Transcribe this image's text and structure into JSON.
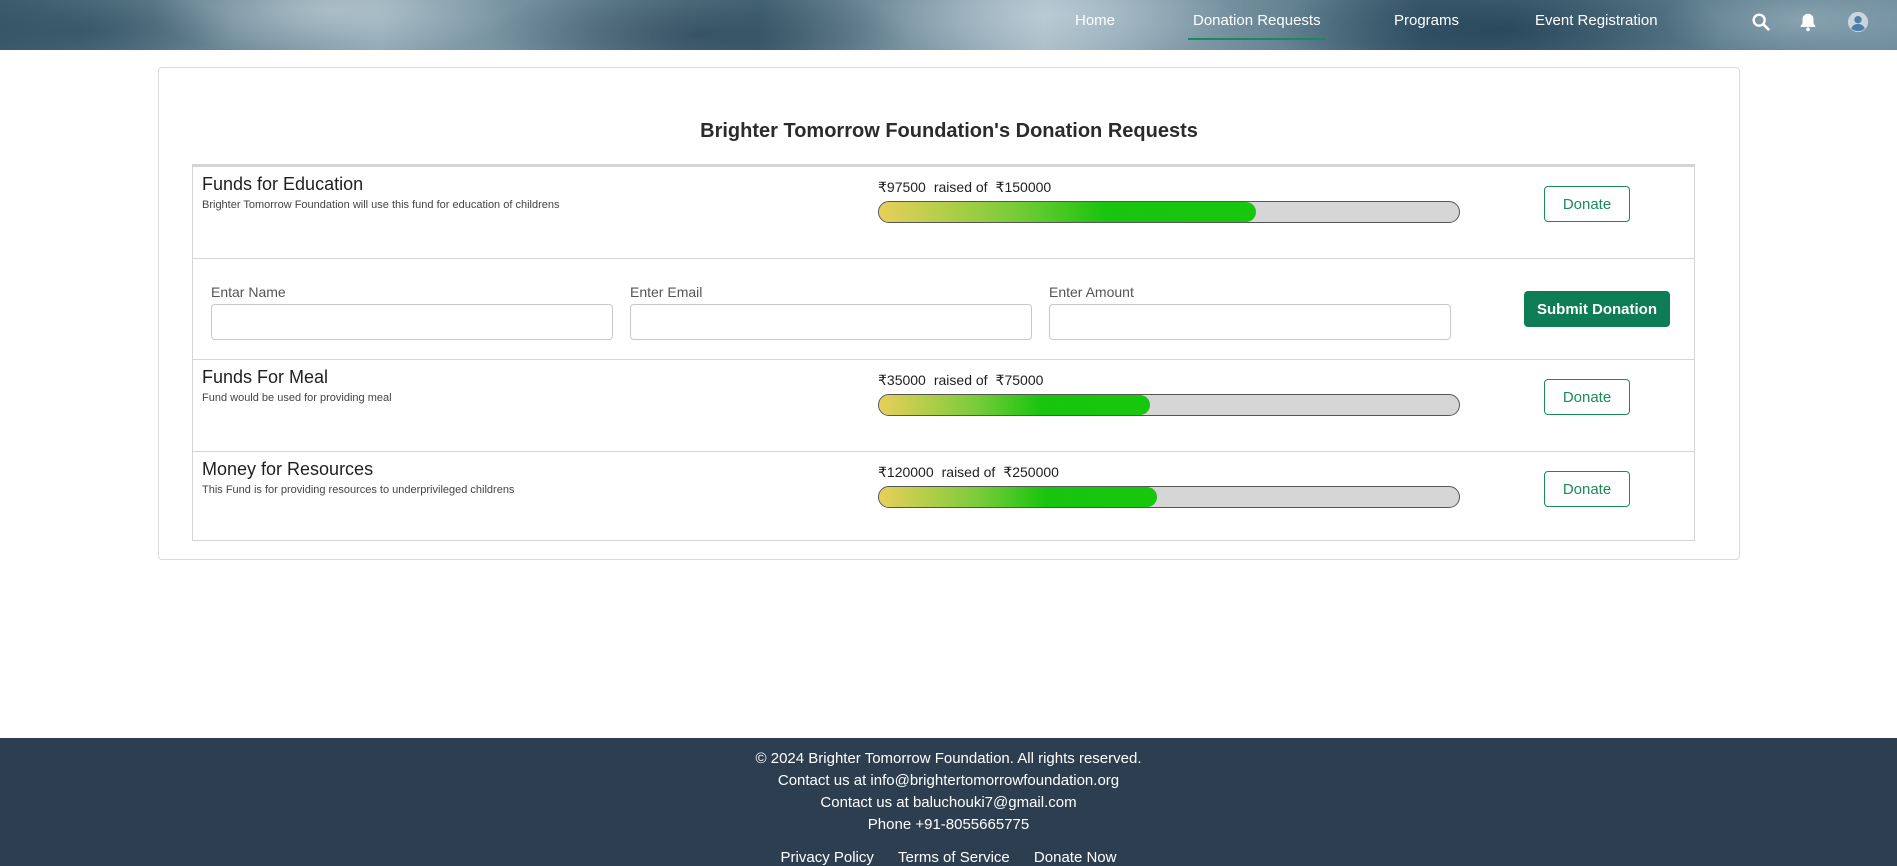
{
  "nav": {
    "items": [
      {
        "label": "Home"
      },
      {
        "label": "Donation Requests"
      },
      {
        "label": "Programs"
      },
      {
        "label": "Event Registration"
      }
    ],
    "icons": [
      "search-icon",
      "bell-icon",
      "user-avatar-icon"
    ]
  },
  "page": {
    "title": "Brighter Tomorrow Foundation's Donation Requests"
  },
  "funds": [
    {
      "name": "Funds for Education",
      "description": "Brighter Tomorrow Foundation will use this fund for education of childrens",
      "raised": "₹97500",
      "raised_of": "raised of",
      "goal": "₹150000",
      "progress_percent": 65,
      "donate_label": "Donate"
    },
    {
      "name": "Funds For Meal",
      "description": "Fund would be used for providing meal",
      "raised": "₹35000",
      "raised_of": "raised of",
      "goal": "₹75000",
      "progress_percent": 46.7,
      "donate_label": "Donate"
    },
    {
      "name": "Money for Resources",
      "description": "This Fund is for providing resources to underprivileged childrens",
      "raised": "₹120000",
      "raised_of": "raised of",
      "goal": "₹250000",
      "progress_percent": 48,
      "donate_label": "Donate"
    }
  ],
  "donation_form": {
    "name_label": "Entar Name",
    "name_value": "",
    "email_label": "Enter Email",
    "email_value": "",
    "amount_label": "Enter Amount",
    "amount_value": "",
    "submit_label": "Submit Donation"
  },
  "footer": {
    "copyright": "© 2024 Brighter Tomorrow Foundation. All rights reserved.",
    "contact_email_1": "Contact us at info@brightertomorrowfoundation.org",
    "contact_email_2": "Contact us at baluchouki7@gmail.com",
    "phone": "Phone +91-8055665775",
    "links": [
      {
        "label": "Privacy Policy"
      },
      {
        "label": "Terms of Service"
      },
      {
        "label": "Donate Now"
      }
    ]
  },
  "colors": {
    "accent": "#1b8a5a",
    "submit_bg": "#0e7c55",
    "footer_bg": "#2c3e50",
    "progress_green": "#19c40f",
    "progress_yellow": "#e8cf5a"
  }
}
